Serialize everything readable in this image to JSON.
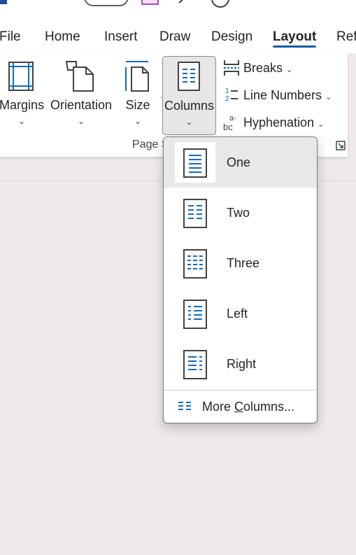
{
  "colors": {
    "accent": "#115ea3",
    "icon_blue": "#0f6cbd",
    "ribbon_bg": "#ffffff",
    "canvas_bg": "#efe9e9"
  },
  "menu": {
    "tabs": [
      {
        "label": "File"
      },
      {
        "label": "Home"
      },
      {
        "label": "Insert"
      },
      {
        "label": "Draw"
      },
      {
        "label": "Design"
      },
      {
        "label": "Layout",
        "active": true
      },
      {
        "label": "Ref"
      }
    ]
  },
  "ribbon": {
    "margins": {
      "label": "Margins",
      "icon": "margins-icon"
    },
    "orientation": {
      "label": "Orientation",
      "icon": "orientation-icon"
    },
    "size": {
      "label": "Size",
      "icon": "size-icon"
    },
    "columns": {
      "label": "Columns",
      "icon": "columns-icon",
      "expanded": true
    },
    "breaks": {
      "label": "Breaks",
      "icon": "breaks-icon"
    },
    "line_numbers": {
      "label": "Line Numbers",
      "icon": "line-numbers-icon"
    },
    "hyphenation": {
      "label": "Hyphenation",
      "icon": "hyphenation-icon"
    },
    "group_label": "Page S"
  },
  "columns_menu": {
    "items": [
      {
        "label": "One",
        "selected": true,
        "icon": "one-column-icon"
      },
      {
        "label": "Two",
        "icon": "two-columns-icon"
      },
      {
        "label": "Three",
        "icon": "three-columns-icon"
      },
      {
        "label": "Left",
        "icon": "left-column-icon"
      },
      {
        "label": "Right",
        "icon": "right-column-icon"
      }
    ],
    "more": {
      "label_pre": "More ",
      "label_access": "C",
      "label_post": "olumns...",
      "icon": "more-columns-icon"
    }
  }
}
